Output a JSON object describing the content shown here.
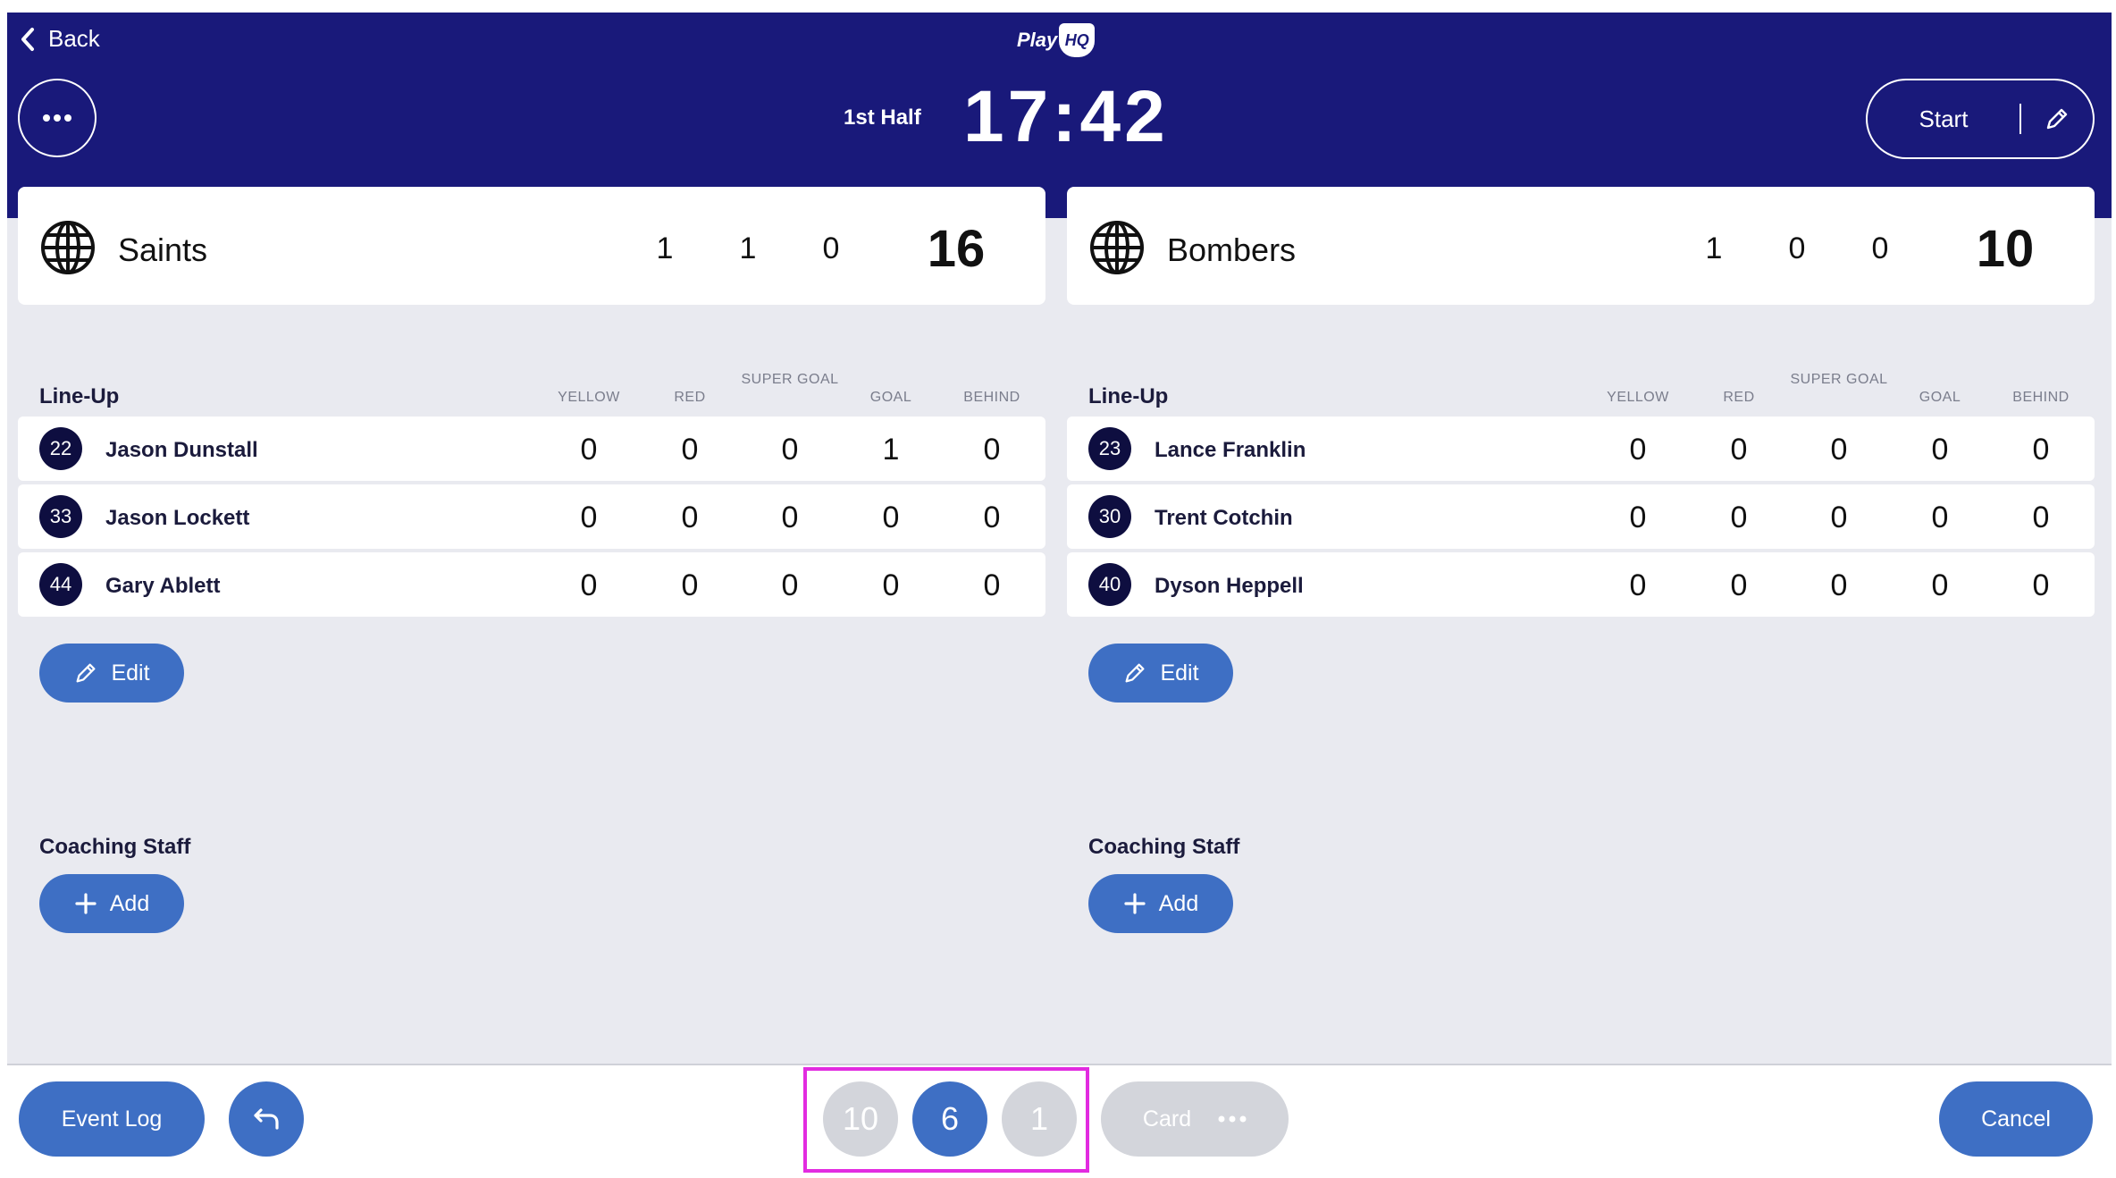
{
  "header": {
    "back_label": "Back",
    "logo_text": "Play",
    "logo_badge": "HQ",
    "period": "1st Half",
    "clock": "17:42",
    "start_label": "Start"
  },
  "teams": [
    {
      "name": "Saints",
      "stats": [
        "1",
        "1",
        "0"
      ],
      "total": "16"
    },
    {
      "name": "Bombers",
      "stats": [
        "1",
        "0",
        "0"
      ],
      "total": "10"
    }
  ],
  "lineup": {
    "title": "Line-Up",
    "columns": [
      "YELLOW",
      "RED",
      "SUPER GOAL",
      "GOAL",
      "BEHIND"
    ]
  },
  "players": {
    "left": [
      {
        "num": "22",
        "name": "Jason Dunstall",
        "vals": [
          "0",
          "0",
          "0",
          "1",
          "0"
        ]
      },
      {
        "num": "33",
        "name": "Jason Lockett",
        "vals": [
          "0",
          "0",
          "0",
          "0",
          "0"
        ]
      },
      {
        "num": "44",
        "name": "Gary Ablett",
        "vals": [
          "0",
          "0",
          "0",
          "0",
          "0"
        ]
      }
    ],
    "right": [
      {
        "num": "23",
        "name": "Lance Franklin",
        "vals": [
          "0",
          "0",
          "0",
          "0",
          "0"
        ]
      },
      {
        "num": "30",
        "name": "Trent Cotchin",
        "vals": [
          "0",
          "0",
          "0",
          "0",
          "0"
        ]
      },
      {
        "num": "40",
        "name": "Dyson Heppell",
        "vals": [
          "0",
          "0",
          "0",
          "0",
          "0"
        ]
      }
    ]
  },
  "actions": {
    "edit_label": "Edit",
    "coaching_title": "Coaching Staff",
    "add_label": "Add"
  },
  "footer": {
    "event_log_label": "Event Log",
    "score_options": [
      "10",
      "6",
      "1"
    ],
    "card_label": "Card",
    "cancel_label": "Cancel"
  },
  "colors": {
    "header_bg": "#19197a",
    "accent": "#3e6fc4",
    "selected_option": "#3e6fc4",
    "disabled": "#d3d5db",
    "highlight": "#e22be0"
  }
}
